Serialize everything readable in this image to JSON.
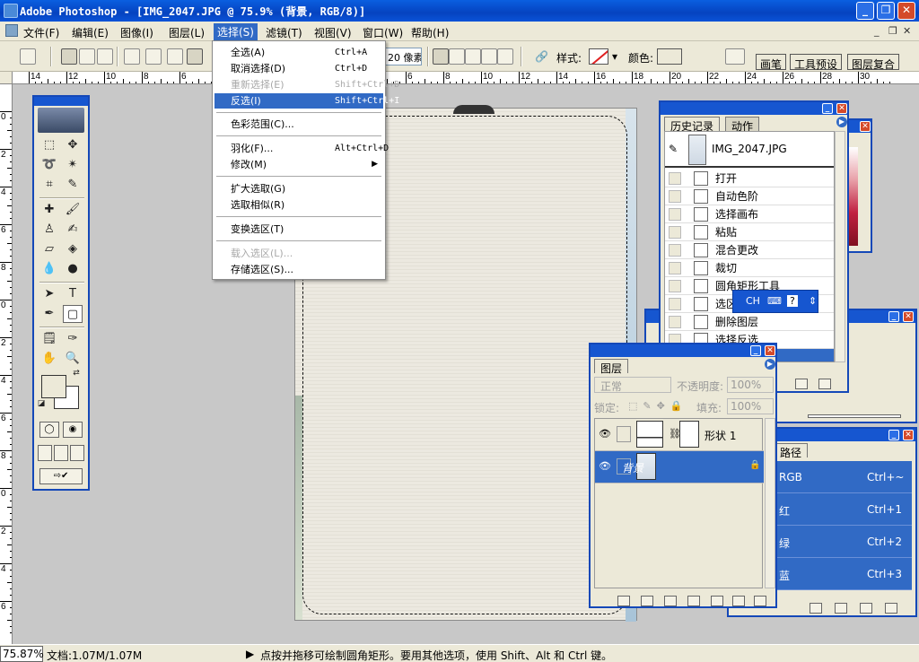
{
  "window": {
    "title": "Adobe Photoshop - [IMG_2047.JPG @ 75.9% (背景, RGB/8)]",
    "minimize": "_",
    "maximize": "❐",
    "close": "✕"
  },
  "menubar": {
    "items": [
      "文件(F)",
      "编辑(E)",
      "图像(I)",
      "图层(L)",
      "选择(S)",
      "滤镜(T)",
      "视图(V)",
      "窗口(W)",
      "帮助(H)"
    ],
    "active": "选择(S)",
    "mdi_min": "_",
    "mdi_restore": "❐",
    "mdi_close": "✕"
  },
  "options": {
    "radius_value": "20 像素",
    "style_label": "样式:",
    "color_label": "颜色:",
    "wells": [
      "画笔",
      "工具预设",
      "图层复合"
    ]
  },
  "ruler": {
    "h_labels": [
      "14",
      "12",
      "10",
      "8",
      "6",
      "4",
      "2",
      "0",
      "2",
      "4",
      "6",
      "8",
      "10",
      "12",
      "14",
      "16",
      "18",
      "20",
      "22",
      "24",
      "26",
      "28",
      "30"
    ],
    "v_labels": [
      "0",
      "2",
      "4",
      "6",
      "8",
      "0",
      "2",
      "4",
      "6",
      "8",
      "0",
      "2",
      "4",
      "6"
    ]
  },
  "select_menu": {
    "items": [
      {
        "label": "全选(A)",
        "shortcut": "Ctrl+A",
        "disabled": false
      },
      {
        "label": "取消选择(D)",
        "shortcut": "Ctrl+D",
        "disabled": false
      },
      {
        "label": "重新选择(E)",
        "shortcut": "Shift+Ctrl+D",
        "disabled": true
      },
      {
        "label": "反选(I)",
        "shortcut": "Shift+Ctrl+I",
        "disabled": false,
        "highlighted": true
      },
      {
        "label": "色彩范围(C)...",
        "shortcut": "",
        "disabled": false
      },
      {
        "label": "羽化(F)...",
        "shortcut": "Alt+Ctrl+D",
        "disabled": false
      },
      {
        "label": "修改(M)",
        "shortcut": "",
        "disabled": false,
        "submenu": true
      },
      {
        "label": "扩大选取(G)",
        "shortcut": "",
        "disabled": false
      },
      {
        "label": "选取相似(R)",
        "shortcut": "",
        "disabled": false
      },
      {
        "label": "变换选区(T)",
        "shortcut": "",
        "disabled": false
      },
      {
        "label": "载入选区(L)...",
        "shortcut": "",
        "disabled": true
      },
      {
        "label": "存储选区(S)...",
        "shortcut": "",
        "disabled": false
      }
    ]
  },
  "history_panel": {
    "tabs": [
      "历史记录",
      "动作"
    ],
    "snapshot": "IMG_2047.JPG",
    "steps": [
      "打开",
      "自动色阶",
      "选择画布",
      "粘贴",
      "混合更改",
      "裁切",
      "圆角矩形工具",
      "选区",
      "删除图层",
      "选择反选"
    ]
  },
  "ime": {
    "label": "CH",
    "help": "?"
  },
  "layers_panel": {
    "tab": "图层",
    "blend_mode": "正常",
    "opacity_label": "不透明度:",
    "opacity_value": "100%",
    "lock_label": "锁定:",
    "fill_label": "填充:",
    "fill_value": "100%",
    "layers": [
      {
        "name": "形状 1",
        "selected": false
      },
      {
        "name": "背景",
        "selected": true
      }
    ]
  },
  "channels_panel": {
    "tab": "路径",
    "channels": [
      {
        "name": "RGB",
        "shortcut": "Ctrl+~"
      },
      {
        "name": "红",
        "shortcut": "Ctrl+1"
      },
      {
        "name": "绿",
        "shortcut": "Ctrl+2"
      },
      {
        "name": "蓝",
        "shortcut": "Ctrl+3"
      }
    ]
  },
  "status": {
    "zoom": "75.87%",
    "doc": "文档:1.07M/1.07M",
    "hint": "点按并拖移可绘制圆角矩形。要用其他选项，使用 Shift、Alt 和 Ctrl 键。"
  },
  "colors": {
    "title_blue": "#0a53d8",
    "menu_highlight": "#316ac5",
    "face": "#ece9d8"
  }
}
